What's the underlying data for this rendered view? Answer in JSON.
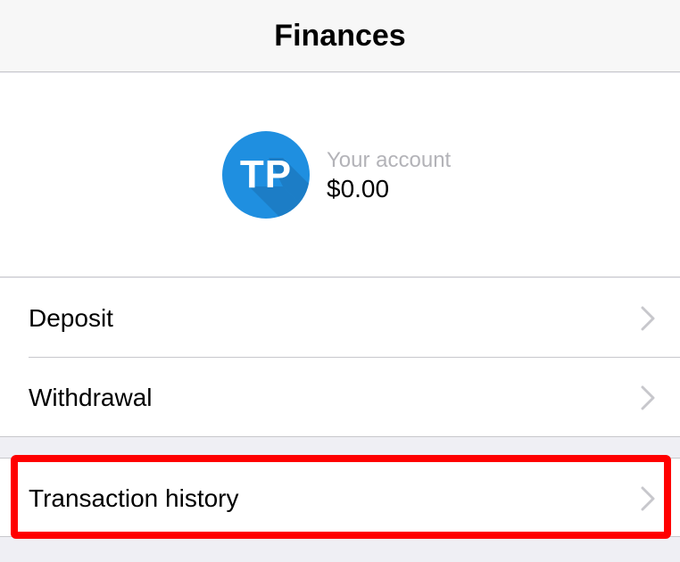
{
  "header": {
    "title": "Finances"
  },
  "account": {
    "avatar_initials": "TP",
    "label": "Your account",
    "balance": "$0.00"
  },
  "menu": {
    "items": [
      {
        "label": "Deposit",
        "icon": "chevron-right-icon"
      },
      {
        "label": "Withdrawal",
        "icon": "chevron-right-icon"
      },
      {
        "label": "Transaction history",
        "icon": "chevron-right-icon"
      }
    ]
  },
  "colors": {
    "avatar_bg": "#1f8fe0",
    "highlight": "#ff0000",
    "page_bg": "#efeff4"
  }
}
